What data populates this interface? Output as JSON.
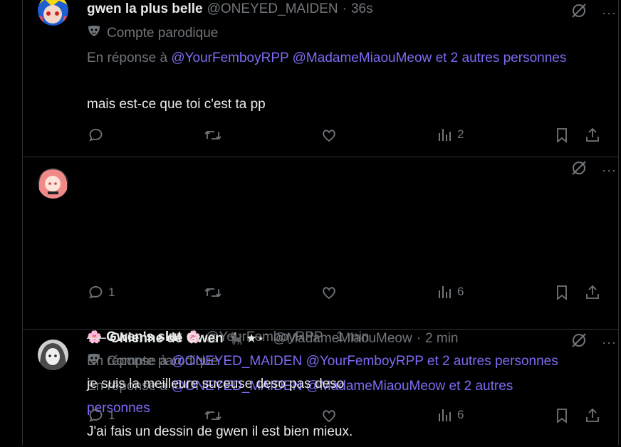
{
  "tweets": [
    {
      "name": "gwen la plus belle",
      "handle": "@ONEYED_MAIDEN",
      "dot": "·",
      "time": "36s",
      "parody_label": "Compte parodique",
      "reply_prefix": "En réponse à",
      "mention1": "@YourFemboyRPP",
      "mention2": "@MadameMiaouMeow",
      "mention_more": "et 2 autres personnes",
      "text": "mais est-ce que toi c'est ta pp",
      "stats": {
        "replies": "",
        "reposts": "",
        "likes": "",
        "views": "2"
      }
    },
    {
      "name_prefix_emoji": "🌸",
      "name": "Gwen's slut",
      "name_suffix_emoji": "🌸",
      "handle": "@YourFemboyRPP",
      "dot": "·",
      "time": "1 min",
      "parody_label": "Compte parodique",
      "reply_prefix": "En réponse à",
      "mention1": "@ONEYED_MAIDEN",
      "mention2": "@MadameMiaouMeow",
      "mention_more": "et 2 autres personnes",
      "text": "J'ai fais un dessin de gwen il est bien mieux.",
      "stats": {
        "replies": "1",
        "reposts": "",
        "likes": "",
        "views": "6"
      }
    },
    {
      "name": "── Chienne de Gwen",
      "name_suffix_emoji": "🐈‍⬛ ★⋆˙",
      "handle": "@MadameMiaouMeow",
      "dot": "·",
      "time": "2 min",
      "reply_prefix": "En réponse à",
      "mention1": "@ONEYED_MAIDEN",
      "mention2": "@YourFemboyRPP",
      "mention_more": "et 2 autres personnes",
      "text": "je suis la meilleure suceuse deso pas deso",
      "stats": {
        "replies": "1",
        "reposts": "",
        "likes": "",
        "views": "6"
      }
    }
  ],
  "icons": {
    "mask": "parody-mask-icon",
    "grok": "grok-icon",
    "more": "···"
  },
  "colors": {
    "background": "#000000",
    "text": "#e7e9ea",
    "muted": "#71767b",
    "mention": "#7c6cf6",
    "border": "#2f3336"
  }
}
